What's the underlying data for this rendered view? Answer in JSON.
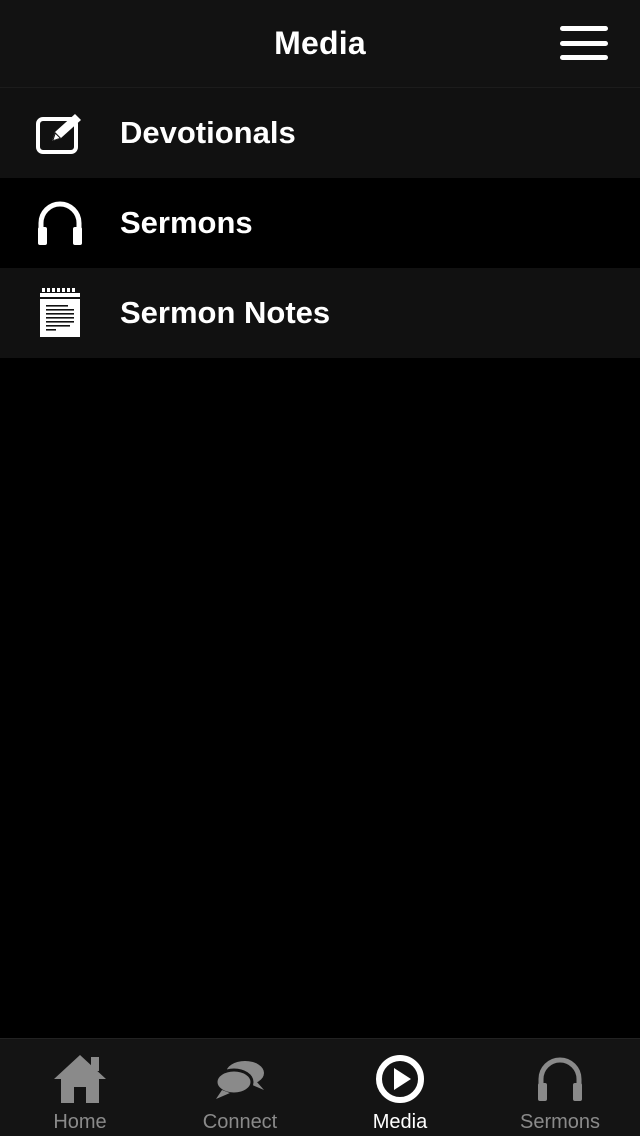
{
  "header": {
    "title": "Media",
    "menu_icon": "hamburger-menu-icon"
  },
  "menu": {
    "items": [
      {
        "label": "Devotionals",
        "icon": "edit-note-icon"
      },
      {
        "label": "Sermons",
        "icon": "headphones-icon"
      },
      {
        "label": "Sermon Notes",
        "icon": "notepad-icon"
      }
    ]
  },
  "tabbar": {
    "tabs": [
      {
        "label": "Home",
        "icon": "home-icon",
        "active": false
      },
      {
        "label": "Connect",
        "icon": "chat-bubbles-icon",
        "active": false
      },
      {
        "label": "Media",
        "icon": "play-circle-icon",
        "active": true
      },
      {
        "label": "Sermons",
        "icon": "headphones-icon",
        "active": false
      }
    ]
  },
  "colors": {
    "background": "#000000",
    "bar": "#121212",
    "row_alt": "#111111",
    "text": "#ffffff",
    "tab_inactive": "#8a8a8a"
  }
}
